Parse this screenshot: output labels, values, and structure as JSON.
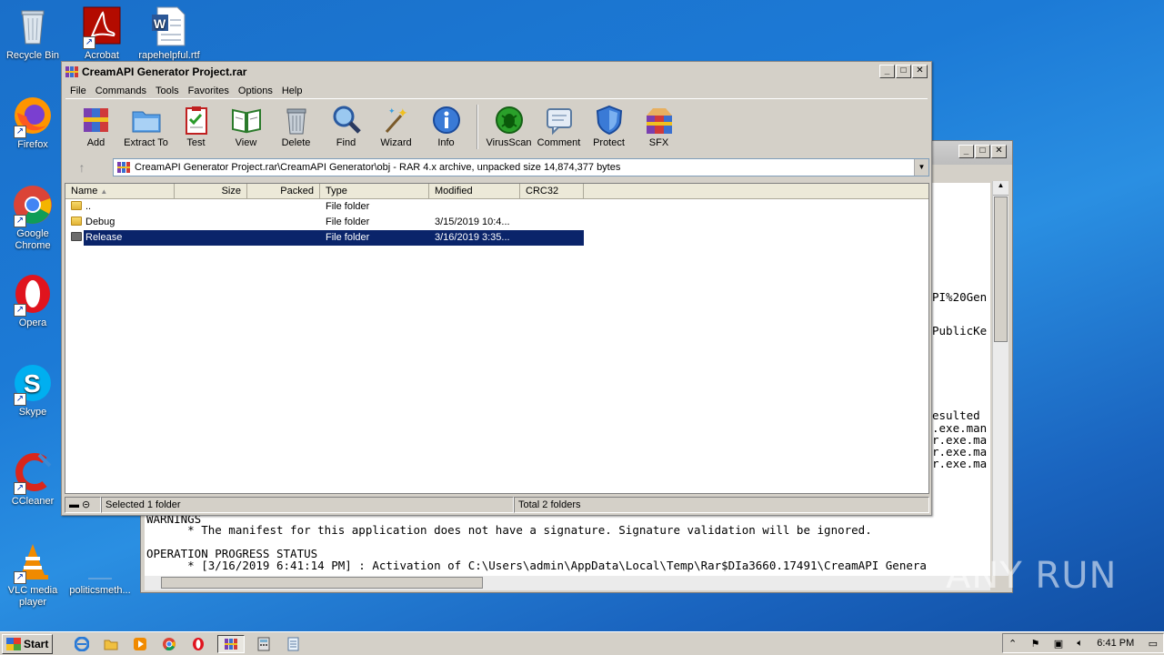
{
  "desktop": {
    "icons": [
      {
        "label": "Recycle Bin"
      },
      {
        "label": "Acrobat"
      },
      {
        "label": "rapehelpful.rtf"
      },
      {
        "label": "Firefox"
      },
      {
        "label": "Google Chrome"
      },
      {
        "label": "Opera"
      },
      {
        "label": "Skype"
      },
      {
        "label": "CCleaner"
      },
      {
        "label": "VLC media player"
      },
      {
        "label": "politicsmeth..."
      }
    ],
    "watermark": "ANY RUN"
  },
  "background_window": {
    "lines": [
      "PI%20Gen",
      "PublicKe",
      "esulted",
      ".exe.man",
      "r.exe.ma",
      "r.exe.ma",
      "r.exe.ma",
      "WARNINGS",
      "      * The manifest for this application does not have a signature. Signature validation will be ignored.",
      "OPERATION PROGRESS STATUS",
      "      * [3/16/2019 6:41:14 PM] : Activation of C:\\Users\\admin\\AppData\\Local\\Temp\\Rar$DIa3660.17491\\CreamAPI Genera"
    ]
  },
  "winrar": {
    "title": "CreamAPI Generator Project.rar",
    "menu": [
      "File",
      "Commands",
      "Tools",
      "Favorites",
      "Options",
      "Help"
    ],
    "toolbar": [
      "Add",
      "Extract To",
      "Test",
      "View",
      "Delete",
      "Find",
      "Wizard",
      "Info",
      "VirusScan",
      "Comment",
      "Protect",
      "SFX"
    ],
    "address": "CreamAPI Generator Project.rar\\CreamAPI Generator\\obj - RAR 4.x archive, unpacked size 14,874,377 bytes",
    "columns": [
      "Name",
      "Size",
      "Packed",
      "Type",
      "Modified",
      "CRC32"
    ],
    "rows": [
      {
        "name": "..",
        "size": "",
        "packed": "",
        "type": "File folder",
        "modified": "",
        "crc": ""
      },
      {
        "name": "Debug",
        "size": "",
        "packed": "",
        "type": "File folder",
        "modified": "3/15/2019 10:4...",
        "crc": ""
      },
      {
        "name": "Release",
        "size": "",
        "packed": "",
        "type": "File folder",
        "modified": "3/16/2019 3:35...",
        "crc": ""
      }
    ],
    "status_left": "Selected 1 folder",
    "status_right": "Total 2 folders"
  },
  "taskbar": {
    "start": "Start",
    "clock": "6:41 PM"
  }
}
